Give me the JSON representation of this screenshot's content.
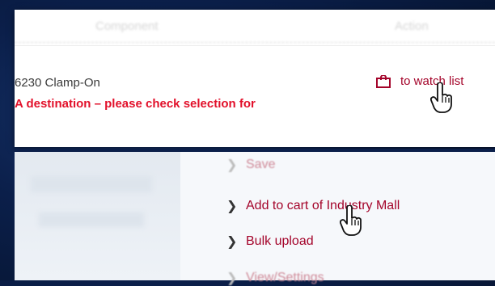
{
  "table_header": {
    "col_product": "Component",
    "col_action": "Action"
  },
  "product_name": "6230 Clamp-On",
  "warning_text": "A destination – please check selection for",
  "watch_label": "to watch list",
  "menu": {
    "items": [
      {
        "label": "Save",
        "state": "faded"
      },
      {
        "label": "Add to cart of Industry Mall",
        "state": "active"
      },
      {
        "label": "Bulk upload",
        "state": "active"
      },
      {
        "label": "View/Settings",
        "state": "faded"
      }
    ]
  },
  "colors": {
    "link": "#a4042a",
    "warning": "#e2102a",
    "background": "#0b1f4a"
  },
  "icons": [
    "shopping-bag-icon",
    "chevron-right-icon",
    "hand-pointer-icon"
  ]
}
